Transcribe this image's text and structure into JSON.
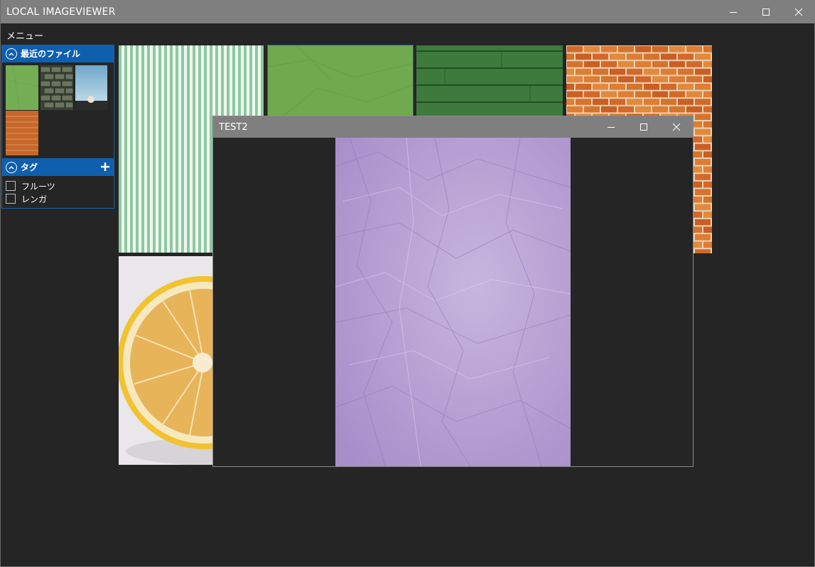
{
  "window": {
    "title": "LOCAL IMAGEVIEWER"
  },
  "menu": {
    "label": "メニュー"
  },
  "recent_files": {
    "title": "最近のファイル"
  },
  "tags": {
    "title": "タグ",
    "items": [
      {
        "label": "フルーツ"
      },
      {
        "label": "レンガ"
      }
    ]
  },
  "viewer": {
    "title": "TEST2"
  },
  "colors": {
    "titlebar": "#7f7f7f",
    "accent": "#0e5fae",
    "background": "#252525"
  },
  "icons": [
    "minimize-icon",
    "maximize-icon",
    "close-icon",
    "chevron-up-circle-icon",
    "plus-icon"
  ]
}
